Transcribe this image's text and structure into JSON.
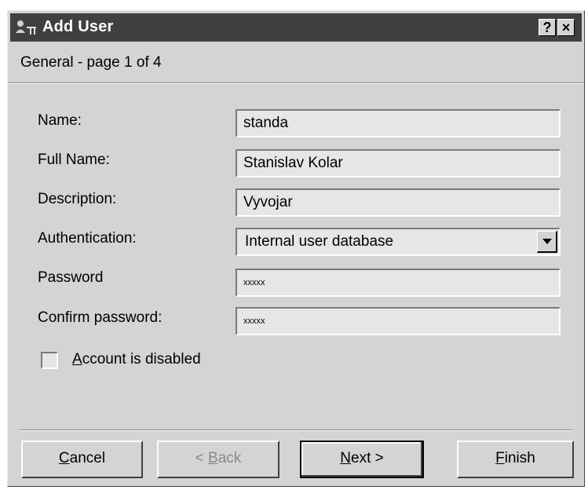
{
  "window": {
    "title": "Add User",
    "help_button": "?",
    "close_button": "×"
  },
  "page_header": "General - page 1 of 4",
  "form": {
    "name_label": "Name:",
    "name_value": "standa",
    "fullname_label": "Full Name:",
    "fullname_value": "Stanislav Kolar",
    "description_label": "Description:",
    "description_value": "Vyvojar",
    "authentication_label": "Authentication:",
    "authentication_value": "Internal user database",
    "password_label": "Password",
    "password_value": "xxxxx",
    "confirm_label": "Confirm password:",
    "confirm_value": "xxxxx",
    "disabled_checkbox_label": "Account is disabled",
    "disabled_checked": false
  },
  "buttons": {
    "cancel_accel": "C",
    "cancel_rest": "ancel",
    "back_prefix": "< ",
    "back_accel": "B",
    "back_rest": "ack",
    "next_accel": "N",
    "next_rest": "ext >",
    "finish_accel": "F",
    "finish_rest": "inish"
  }
}
